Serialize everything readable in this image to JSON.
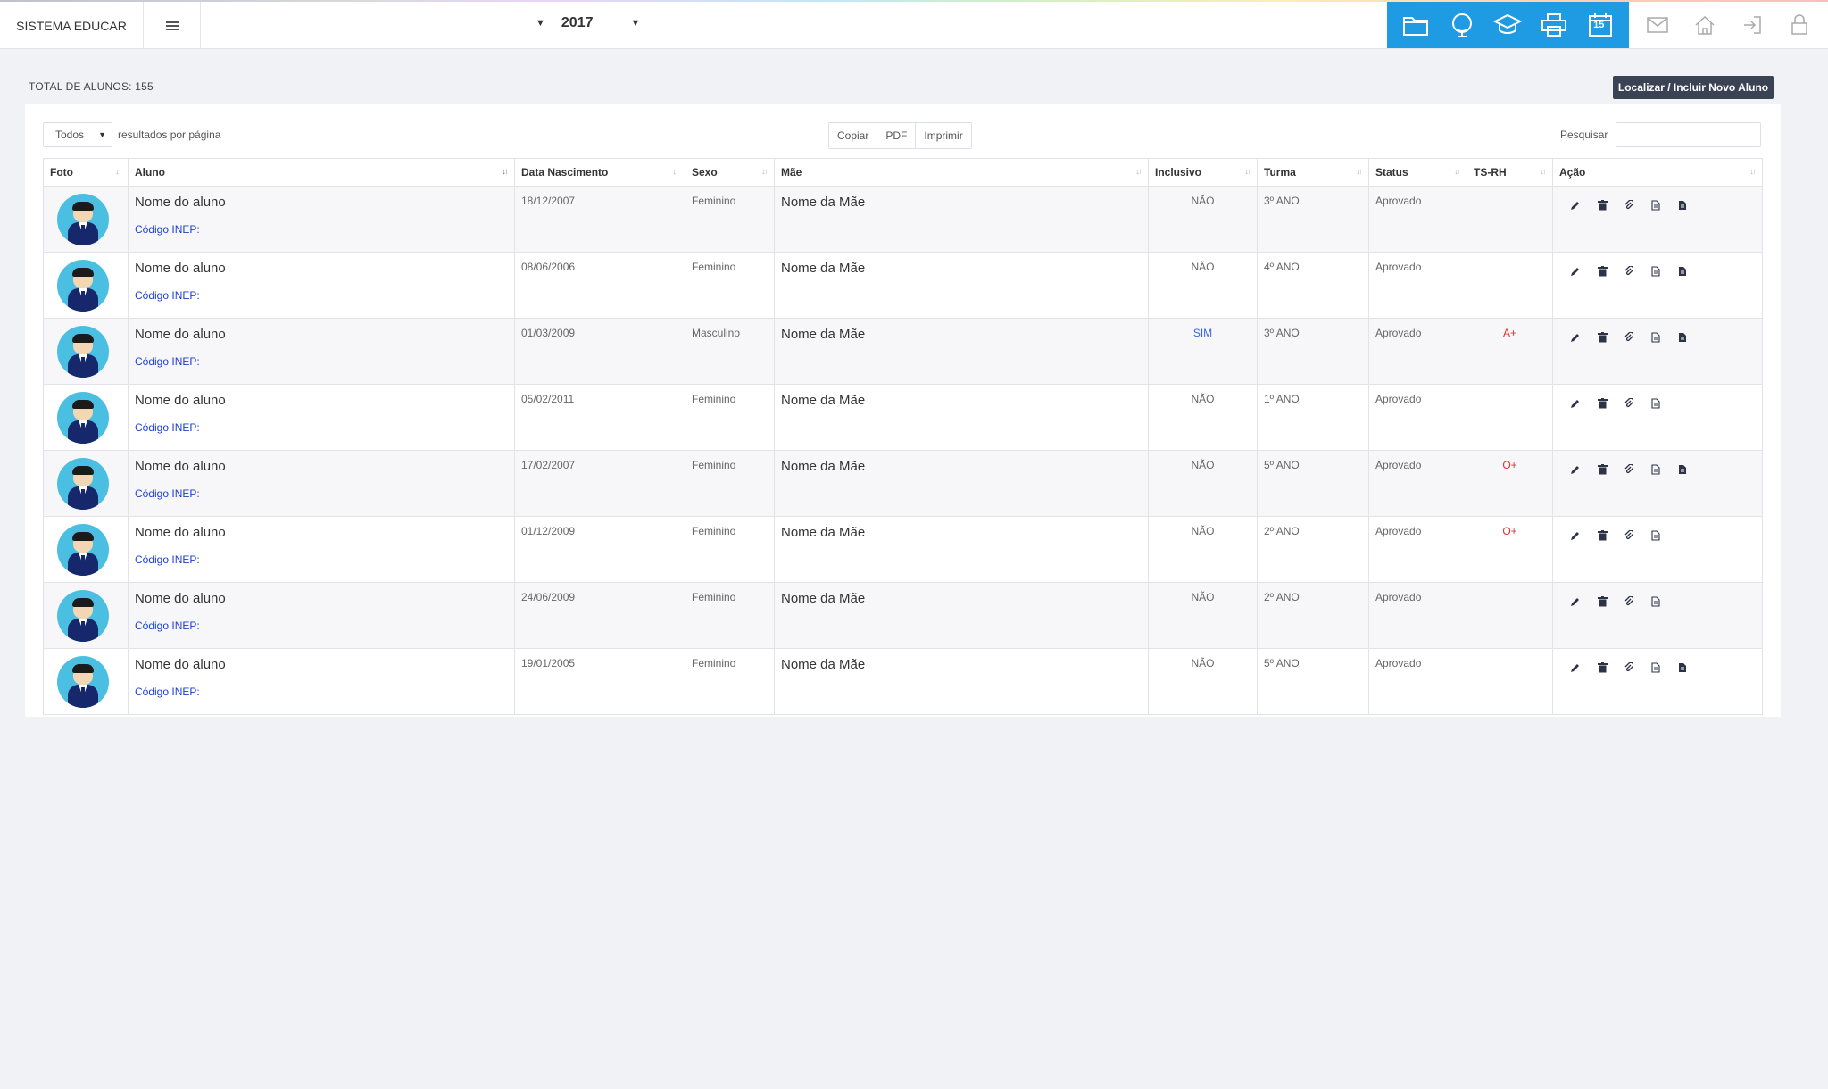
{
  "app": {
    "brand": "SISTEMA EDUCAR",
    "year": "2017"
  },
  "header_icons": {
    "blue": [
      "folder-icon",
      "globe-icon",
      "graduation-cap-icon",
      "printer-icon",
      "calendar-icon"
    ],
    "calendar_day": "15",
    "gray": [
      "envelope-icon",
      "home-icon",
      "sign-out-icon",
      "lock-icon"
    ],
    "blue_color": "#1e9be2"
  },
  "summary": {
    "total_label": "TOTAL DE ALUNOS: 155",
    "new_button": "Localizar / Incluir Novo Aluno"
  },
  "controls": {
    "length_value": "Todos",
    "length_label": "resultados por página",
    "export": [
      "Copiar",
      "PDF",
      "Imprimir"
    ],
    "search_label": "Pesquisar",
    "search_value": ""
  },
  "table": {
    "columns": [
      "Foto",
      "Aluno",
      "Data Nascimento",
      "Sexo",
      "Mãe",
      "Inclusivo",
      "Turma",
      "Status",
      "TS-RH",
      "Ação"
    ],
    "inep_label": "Código INEP:",
    "rows": [
      {
        "aluno": "Nome do aluno",
        "nascimento": "18/12/2007",
        "sexo": "Feminino",
        "mae": "Nome da Mãe",
        "inclusivo": "NÃO",
        "turma": "3º ANO",
        "status": "Aprovado",
        "tsrh": "",
        "doc": true
      },
      {
        "aluno": "Nome do aluno",
        "nascimento": "08/06/2006",
        "sexo": "Feminino",
        "mae": "Nome da Mãe",
        "inclusivo": "NÃO",
        "turma": "4º ANO",
        "status": "Aprovado",
        "tsrh": "",
        "doc": true
      },
      {
        "aluno": "Nome do aluno",
        "nascimento": "01/03/2009",
        "sexo": "Masculino",
        "mae": "Nome da Mãe",
        "inclusivo": "SIM",
        "turma": "3º ANO",
        "status": "Aprovado",
        "tsrh": "A+",
        "doc": true
      },
      {
        "aluno": "Nome do aluno",
        "nascimento": "05/02/2011",
        "sexo": "Feminino",
        "mae": "Nome da Mãe",
        "inclusivo": "NÃO",
        "turma": "1º ANO",
        "status": "Aprovado",
        "tsrh": "",
        "doc": false
      },
      {
        "aluno": "Nome do aluno",
        "nascimento": "17/02/2007",
        "sexo": "Feminino",
        "mae": "Nome da Mãe",
        "inclusivo": "NÃO",
        "turma": "5º ANO",
        "status": "Aprovado",
        "tsrh": "O+",
        "doc": true
      },
      {
        "aluno": "Nome do aluno",
        "nascimento": "01/12/2009",
        "sexo": "Feminino",
        "mae": "Nome da Mãe",
        "inclusivo": "NÃO",
        "turma": "2º ANO",
        "status": "Aprovado",
        "tsrh": "O+",
        "doc": false
      },
      {
        "aluno": "Nome do aluno",
        "nascimento": "24/06/2009",
        "sexo": "Feminino",
        "mae": "Nome da Mãe",
        "inclusivo": "NÃO",
        "turma": "2º ANO",
        "status": "Aprovado",
        "tsrh": "",
        "doc": false
      },
      {
        "aluno": "Nome do aluno",
        "nascimento": "19/01/2005",
        "sexo": "Feminino",
        "mae": "Nome da Mãe",
        "inclusivo": "NÃO",
        "turma": "5º ANO",
        "status": "Aprovado",
        "tsrh": "",
        "doc": true
      }
    ]
  }
}
